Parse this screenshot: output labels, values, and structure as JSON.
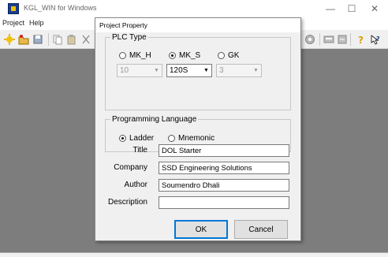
{
  "app": {
    "title": "KGL_WIN for Windows",
    "controls": {
      "minimize": "—",
      "maximize": "☐",
      "close": "✕"
    }
  },
  "menu": {
    "items": [
      "Project",
      "Help"
    ]
  },
  "toolbar": {
    "left_icons": [
      "new-project-icon",
      "open-project-icon",
      "save-project-icon",
      "copy-icon",
      "paste-icon",
      "cut-icon"
    ],
    "right_icons": [
      "monitor-icon",
      "compile-icon",
      "download-icon",
      "help-icon",
      "context-help-icon"
    ]
  },
  "dialog": {
    "title": "Project Property",
    "plc_type": {
      "legend": "PLC Type",
      "options": [
        {
          "label": "MK_H",
          "selected": false,
          "combo_value": "10",
          "combo_enabled": false
        },
        {
          "label": "MK_S",
          "selected": true,
          "combo_value": "120S",
          "combo_enabled": true
        },
        {
          "label": "GK",
          "selected": false,
          "combo_value": "3",
          "combo_enabled": false
        }
      ]
    },
    "programming_language": {
      "legend": "Programming Language",
      "options": [
        {
          "label": "Ladder",
          "selected": true
        },
        {
          "label": "Mnemonic",
          "selected": false
        }
      ]
    },
    "fields": {
      "title": {
        "label": "Title",
        "value": "DOL Starter"
      },
      "company": {
        "label": "Company",
        "value": "SSD Engineering Solutions"
      },
      "author": {
        "label": "Author",
        "value": "Soumendro Dhali"
      },
      "description": {
        "label": "Description",
        "value": ""
      }
    },
    "buttons": {
      "ok": "OK",
      "cancel": "Cancel"
    }
  },
  "colors": {
    "workspace": "#7d7d7d",
    "dialog_bg": "#f0f0f0",
    "default_button_border": "#0078d7"
  }
}
